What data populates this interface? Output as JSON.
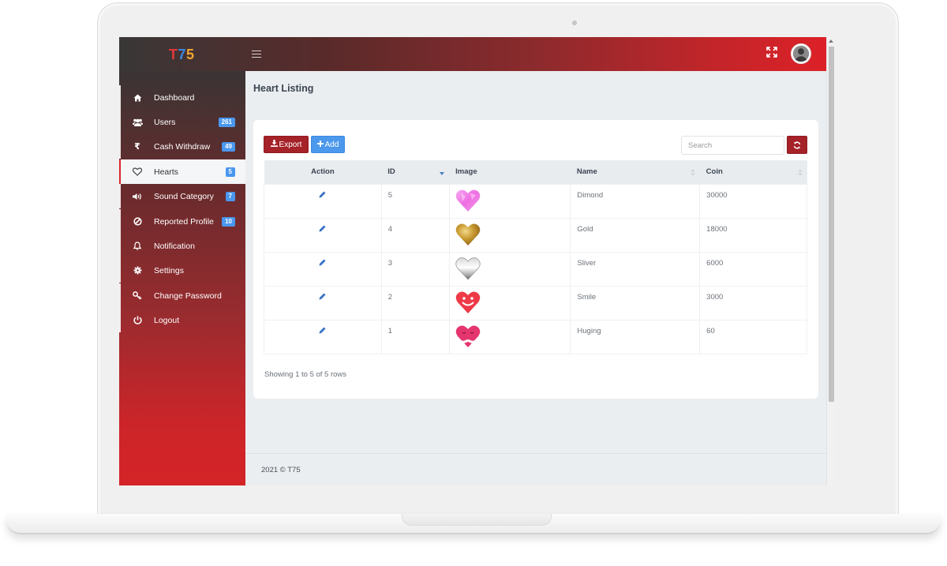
{
  "app": {
    "logo": {
      "t": "T",
      "seven": "7",
      "five": "5"
    }
  },
  "topbar": {
    "menu_icon": "hamburger-icon",
    "fullscreen_icon": "expand-icon",
    "avatar_icon": "user-avatar-icon"
  },
  "sidebar": {
    "items": [
      {
        "label": "Dashboard",
        "icon": "home-icon",
        "badge": null,
        "active": false
      },
      {
        "label": "Users",
        "icon": "users-icon",
        "badge": "261",
        "active": false
      },
      {
        "label": "Cash Withdraw",
        "icon": "rupee-icon",
        "badge": "49",
        "active": false
      },
      {
        "label": "Hearts",
        "icon": "heart-icon",
        "badge": "5",
        "active": true
      },
      {
        "label": "Sound Category",
        "icon": "volume-icon",
        "badge": "7",
        "active": false
      },
      {
        "label": "Reported Profile",
        "icon": "ban-icon",
        "badge": "10",
        "active": false
      },
      {
        "label": "Notification",
        "icon": "bell-icon",
        "badge": null,
        "active": false
      },
      {
        "label": "Settings",
        "icon": "gear-icon",
        "badge": null,
        "active": false
      },
      {
        "label": "Change Password",
        "icon": "key-icon",
        "badge": null,
        "active": false
      },
      {
        "label": "Logout",
        "icon": "power-icon",
        "badge": null,
        "active": false
      }
    ]
  },
  "main": {
    "page_title": "Heart Listing",
    "toolbar": {
      "export_label": "Export",
      "add_label": "Add",
      "search_placeholder": "Search",
      "search_value": ""
    },
    "table": {
      "columns": [
        "Action",
        "ID",
        "Image",
        "Name",
        "Coin"
      ],
      "rows": [
        {
          "id": "5",
          "image": "pink-diamond-heart",
          "name": "Dimond",
          "coin": "30000"
        },
        {
          "id": "4",
          "image": "gold-heart",
          "name": "Gold",
          "coin": "18000"
        },
        {
          "id": "3",
          "image": "silver-heart",
          "name": "Sliver",
          "coin": "6000"
        },
        {
          "id": "2",
          "image": "smile-heart",
          "name": "Smile",
          "coin": "3000"
        },
        {
          "id": "1",
          "image": "hugging-heart",
          "name": "Huging",
          "coin": "60"
        }
      ]
    },
    "pagination_info": "Showing 1 to 5 of 5 rows"
  },
  "footer": {
    "text": "2021 © T75"
  },
  "colors": {
    "brand_red": "#d9252b",
    "button_dark_red": "#a52228",
    "button_blue": "#4b98ec",
    "badge_blue": "#4a97ee"
  }
}
